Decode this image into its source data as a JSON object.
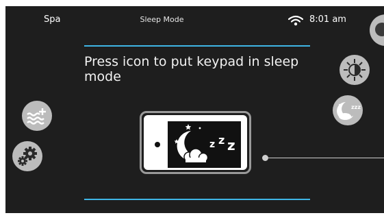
{
  "status_bar": {
    "app_label": "Spa",
    "screen_title": "Sleep Mode",
    "time": "8:01 am",
    "wifi_icon": "wifi-icon"
  },
  "main": {
    "instruction": "Press icon to put keypad in sleep mode",
    "keypad_icon": "keypad-sleep-icon",
    "sleep_glyph": "z z z"
  },
  "left_buttons": [
    {
      "icon": "heat-icon"
    },
    {
      "icon": "settings-icon"
    }
  ],
  "right_buttons": [
    {
      "icon": "brightness-icon"
    },
    {
      "icon": "sleep-icon"
    }
  ],
  "colors": {
    "background": "#1e1e1e",
    "accent_line": "#3fb6e6",
    "button": "#bcbcbc"
  }
}
